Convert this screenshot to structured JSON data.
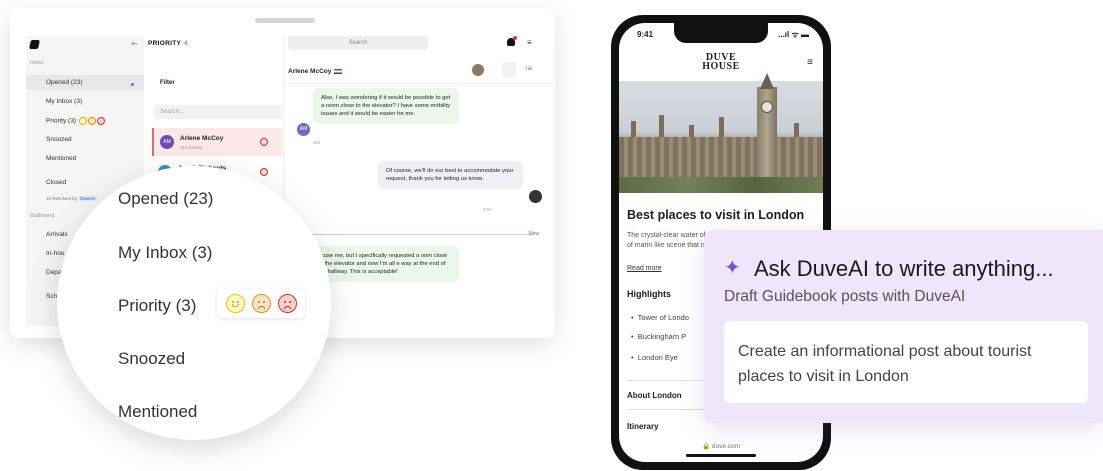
{
  "dashboard": {
    "sidebar": {
      "inbox_section": "Inbox",
      "items": [
        {
          "label": "Opened (23)"
        },
        {
          "label": "My Inbox (3)"
        },
        {
          "label": "Priority (3)"
        },
        {
          "label": "Snoozed"
        },
        {
          "label": "Mentioned"
        },
        {
          "label": "Closed"
        }
      ],
      "closed_sub": "12 Resolved by",
      "closed_badge": "DuveAI",
      "outbound_section": "Outbound",
      "outbound_items": [
        {
          "label": "Arrivals"
        },
        {
          "label": "In-hou"
        },
        {
          "label": "Depa"
        },
        {
          "label": "Sch"
        }
      ]
    },
    "list": {
      "title": "PRIORITY",
      "count": "4",
      "filter_label": "Filter",
      "search_placeholder": "Search...",
      "conversations": [
        {
          "initials": "AM",
          "name": "Arlene McCoy",
          "meta": "214 Deluxe"
        },
        {
          "initials": "JR",
          "name": "Jacob Richards",
          "meta": ""
        }
      ]
    },
    "topbar": {
      "search_placeholder": "Search"
    },
    "chat": {
      "contact_name": "Arlene McCoy",
      "messages": [
        {
          "text": "Also, I was wondering if it would be possible to get a room close to the elevator? I have some mobility issues and it would be easier for me.",
          "avatar": "AM",
          "time": "11h"
        },
        {
          "text": "Of course, we'll do our best to accommodate your request, thank you for letting us know.",
          "time": "47m"
        },
        {
          "text": "xcuse me, but I specifically requested a oom close to the elevator and now I'm all e way at the end of the hallway. This is acceptable!"
        }
      ],
      "new_label": "New"
    }
  },
  "magnifier": {
    "items": [
      "Opened (23)",
      "My Inbox (3)",
      "Priority (3)",
      "Snoozed",
      "Mentioned"
    ]
  },
  "phone": {
    "time": "9:41",
    "status_icons": "...ıl ᯤ ▬",
    "logo_line1": "DUVE",
    "logo_line2": "HOUSE",
    "article_title": "Best places to visit in London",
    "article_desc": "The crystal-clear water of the Greek sea is home to a variety of marin like scene that is tru",
    "read_more": "Read more",
    "highlights_title": "Highlights",
    "highlights": [
      "Tower of Londo",
      "Buckingham P",
      "London Eye"
    ],
    "about": "About London",
    "itinerary": "Itinerary",
    "url": "🔒 duve.com"
  },
  "ai_card": {
    "title": "Ask DuveAI to write anything...",
    "subtitle": "Draft Guidebook posts with DuveAI",
    "prompt": "Create an informational post about tourist places to visit in London"
  },
  "colors": {
    "accent": "#7a4fd6",
    "card_bg": "#eee6fa",
    "selected_row": "#fde8e8"
  }
}
